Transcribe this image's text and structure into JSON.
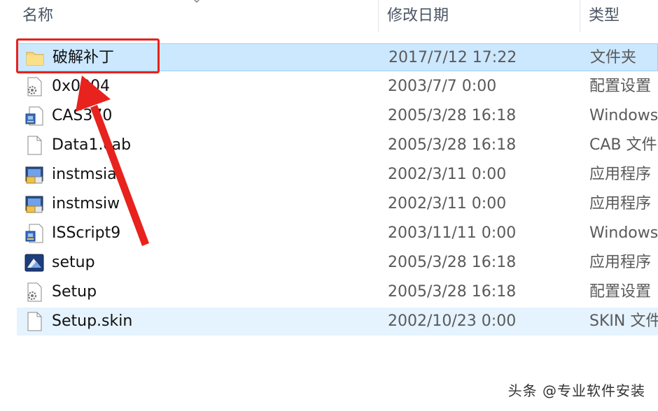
{
  "columns": {
    "name": "名称",
    "date": "修改日期",
    "type": "类型"
  },
  "files": [
    {
      "name": "破解补丁",
      "date": "2017/7/12 17:22",
      "type": "文件夹",
      "icon": "folder-icon",
      "state": "selected"
    },
    {
      "name": "0x0804",
      "date": "2003/7/7 0:00",
      "type": "配置设置",
      "icon": "settings-file-icon",
      "state": ""
    },
    {
      "name": "CAS370",
      "date": "2005/3/28 16:18",
      "type": "Windows",
      "icon": "installer-package-icon",
      "state": ""
    },
    {
      "name": "Data1.cab",
      "date": "2005/3/28 16:18",
      "type": "CAB 文件",
      "icon": "blank-file-icon",
      "state": ""
    },
    {
      "name": "instmsia",
      "date": "2002/3/11 0:00",
      "type": "应用程序",
      "icon": "msi-installer-icon",
      "state": ""
    },
    {
      "name": "instmsiw",
      "date": "2002/3/11 0:00",
      "type": "应用程序",
      "icon": "msi-installer-icon",
      "state": ""
    },
    {
      "name": "ISScript9",
      "date": "2003/11/11 0:00",
      "type": "Windows",
      "icon": "installer-package-icon",
      "state": ""
    },
    {
      "name": "setup",
      "date": "2005/3/28 16:18",
      "type": "应用程序",
      "icon": "setup-app-icon",
      "state": ""
    },
    {
      "name": "Setup",
      "date": "2005/3/28 16:18",
      "type": "配置设置",
      "icon": "settings-file-icon",
      "state": ""
    },
    {
      "name": "Setup.skin",
      "date": "2002/10/23 0:00",
      "type": "SKIN 文件",
      "icon": "blank-file-icon",
      "state": "hover"
    }
  ],
  "watermark": "头条 @专业软件安装",
  "colors": {
    "selection_bg": "#cce8ff",
    "hover_bg": "#e5f3ff",
    "annotation_red": "#e8221d"
  }
}
